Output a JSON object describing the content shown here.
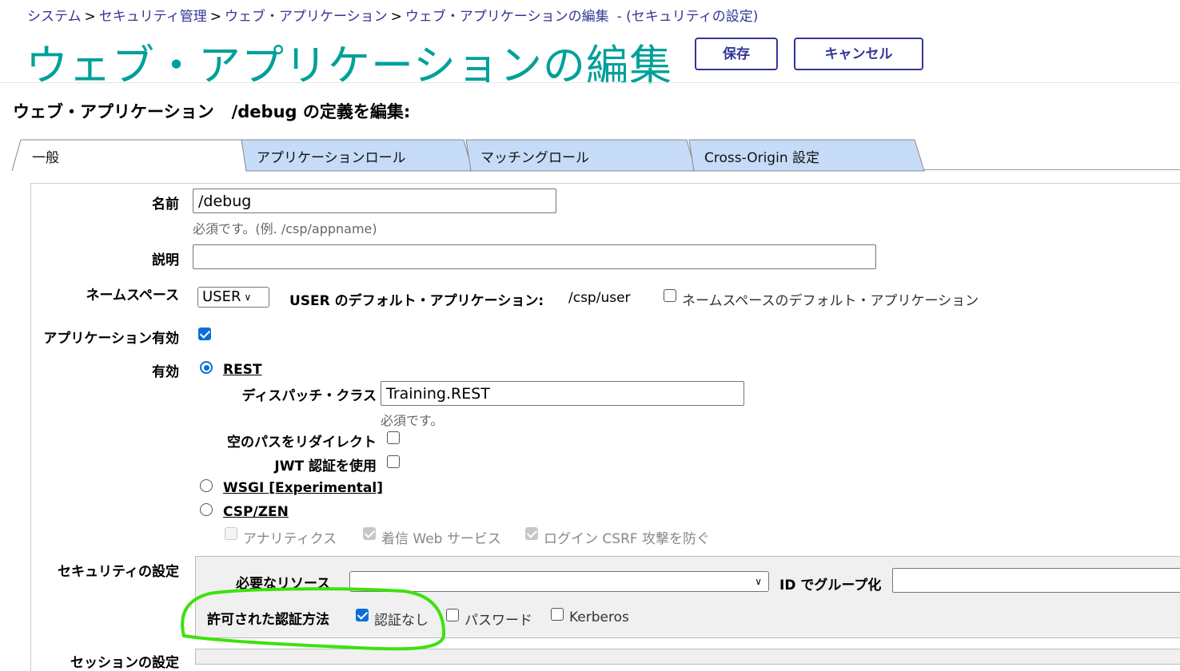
{
  "breadcrumb": {
    "items": [
      "システム",
      "セキュリティ管理",
      "ウェブ・アプリケーション",
      "ウェブ・アプリケーションの編集"
    ],
    "separator": ">",
    "context": "- (セキュリティの設定)"
  },
  "header": {
    "title": "ウェブ・アプリケーションの編集",
    "save_label": "保存",
    "cancel_label": "キャンセル",
    "title_color": "#00a09a",
    "accent_color": "#333695"
  },
  "subtitle": {
    "prefix": "ウェブ・アプリケーション",
    "path": "/debug の定義を編集:"
  },
  "tabs": [
    {
      "label": "一般",
      "active": true
    },
    {
      "label": "アプリケーションロール",
      "active": false
    },
    {
      "label": "マッチングロール",
      "active": false
    },
    {
      "label": "Cross-Origin 設定",
      "active": false
    }
  ],
  "form": {
    "name": {
      "label": "名前",
      "value": "/debug",
      "hint": "必須です。(例. /csp/appname)"
    },
    "description": {
      "label": "説明",
      "value": ""
    },
    "namespace": {
      "label": "ネームスペース",
      "selected": "USER",
      "default_app_label": "USER のデフォルト・アプリケーション:",
      "default_app_value": "/csp/user",
      "ns_default_checkbox_label": "ネームスペースのデフォルト・アプリケーション"
    },
    "app_enabled": {
      "label": "アプリケーション有効",
      "checked": true
    },
    "enable": {
      "label": "有効",
      "rest": {
        "label": "REST",
        "dispatch_label": "ディスパッチ・クラス",
        "dispatch_value": "Training.REST",
        "dispatch_hint": "必須です。",
        "redirect_label": "空のパスをリダイレクト",
        "jwt_label": "JWT 認証を使用"
      },
      "wsgi_label": "WSGI [Experimental]",
      "csp_label": "CSP/ZEN",
      "csp_options": [
        "アナリティクス",
        "着信 Web サービス",
        "ログイン CSRF 攻撃を防ぐ"
      ]
    },
    "security": {
      "label": "セキュリティの設定",
      "resource_label": "必要なリソース",
      "resource_value": "",
      "group_label": "ID でグループ化",
      "group_value": "",
      "auth_label": "許可された認証方法",
      "auth_options": [
        {
          "label": "認証なし",
          "checked": true
        },
        {
          "label": "パスワード",
          "checked": false
        },
        {
          "label": "Kerberos",
          "checked": false
        }
      ]
    },
    "session_label": "セッションの設定"
  },
  "annotation": {
    "color": "#3ee10e"
  }
}
